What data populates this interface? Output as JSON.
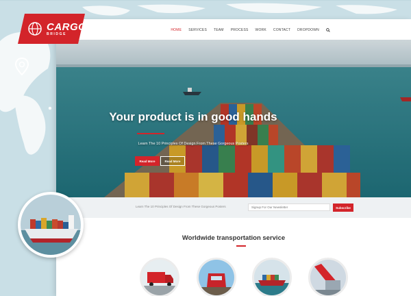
{
  "logo": {
    "name": "CARGO",
    "tagline": "BRIDGE"
  },
  "nav": {
    "items": [
      "HOME",
      "SERVICES",
      "TEAM",
      "PROCESS",
      "WORK",
      "CONTACT",
      "DROPDOWN"
    ],
    "active_index": 0
  },
  "hero": {
    "title": "Your product is in good hands",
    "subtitle": "Learn The 10 Principles Of Design From These Gorgeous Posters",
    "primary_button": "Read More",
    "secondary_button": "Read More"
  },
  "newsletter": {
    "text": "Learn The 10 Principles Of Design From These Gorgeous Posters",
    "placeholder": "Signup For Our Newsletter",
    "button": "Subscribe"
  },
  "services": {
    "title": "Worldwide transportation service",
    "items": [
      "truck",
      "train",
      "ship",
      "cargo-loading"
    ]
  },
  "colors": {
    "accent": "#d3242a",
    "sea": "#2a7d86",
    "map_bg": "#c9dfe6"
  }
}
